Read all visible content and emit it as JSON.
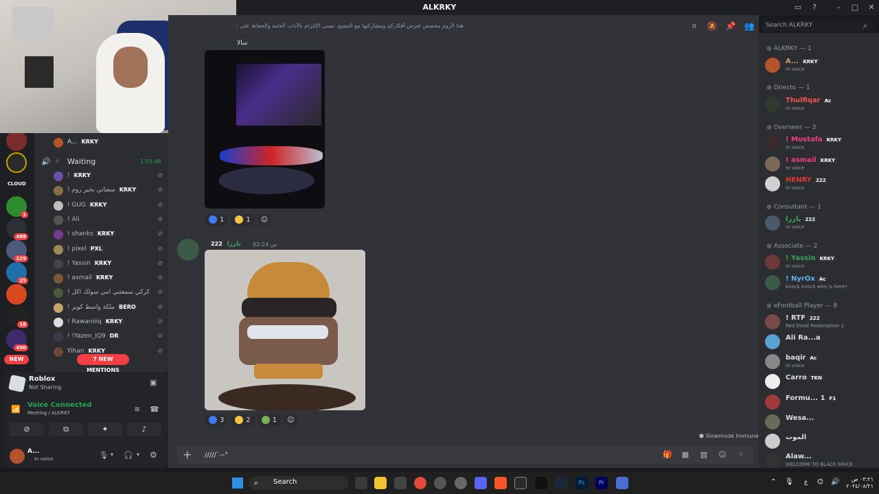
{
  "window": {
    "title": "ALKRKY"
  },
  "header": {
    "topic": "هذا الروم مخصص لعرض أفكاركم ومشاركتها مع الجميع، نتمنى الإلتزام بالآداب العامة والحفاظ على جودة المحتوى",
    "search_placeholder": "Search ALKRKY"
  },
  "sidebar": {
    "server_badges": [
      "1",
      "488",
      "229",
      "25",
      "18",
      "490"
    ],
    "new_label": "NEW",
    "server_logo_text": "CLOUD"
  },
  "voice_list": {
    "top_user": {
      "name": "A...",
      "tag": "KRKY"
    },
    "channel_name": "Waiting",
    "channel_timer": "1:55:46",
    "members": [
      {
        "name": "!",
        "tag": "KRKY"
      },
      {
        "name": "! سعناني بخير روم",
        "tag": "KRKY"
      },
      {
        "name": "! GUG",
        "tag": "KRKY"
      },
      {
        "name": "! Ali",
        "tag": ""
      },
      {
        "name": "! shanks",
        "tag": "KRKY"
      },
      {
        "name": "! pixel",
        "tag": "PXL"
      },
      {
        "name": "! Yassin",
        "tag": "KRKY"
      },
      {
        "name": "! asmail",
        "tag": "KRKY"
      },
      {
        "name": "! كركي سمعتني امي سولك اكل",
        "tag": ""
      },
      {
        "name": "! ملكة واسط كوير",
        "tag": "BERO"
      },
      {
        "name": "! Rawaniiiq",
        "tag": "KRKY"
      },
      {
        "name": "! !Yazen_IQ9",
        "tag": "DR"
      },
      {
        "name": "Yihan",
        "tag": "KRKY"
      }
    ],
    "mentions_label": "7 NEW MENTIONS"
  },
  "activity": {
    "app": "Roblox",
    "status": "Not Sharing"
  },
  "voice_status": {
    "title": "Voice Connected",
    "subtitle": "Meeting / ALKRKY"
  },
  "current_user": {
    "name": "A...",
    "status": "In voice"
  },
  "chat": {
    "first_author_fragment": "سالا",
    "message1_reactions": [
      {
        "emoji": "blue-heart",
        "count": "1"
      },
      {
        "emoji": "laughing",
        "count": "1"
      }
    ],
    "message2": {
      "author": "بارزا",
      "tag": "222",
      "time": "س 02:24"
    },
    "message2_reactions": [
      {
        "emoji": "blue-heart",
        "count": "3"
      },
      {
        "emoji": "laughing",
        "count": "2"
      },
      {
        "emoji": "nauseated",
        "count": "1"
      }
    ],
    "slowmode_label": "Slowmode Immune",
    "composer_text": "/////`--°"
  },
  "members": {
    "roles": [
      {
        "label": "ALKRKY — 1",
        "members": [
          {
            "name": "A...",
            "tag": "KRKY",
            "sub": "In voice",
            "color": "#c9a26a"
          }
        ]
      },
      {
        "label": "Directo — 1",
        "members": [
          {
            "name": "Thulfiqar",
            "tag": "Ac",
            "sub": "In voice",
            "color": "#f2544f"
          }
        ]
      },
      {
        "label": "Overseer — 3",
        "members": [
          {
            "name": "! Mustafa",
            "tag": "KRKY",
            "sub": "In voice",
            "color": "#f23f80"
          },
          {
            "name": "! asmail",
            "tag": "KRKY",
            "sub": "In voice",
            "color": "#f23f80"
          },
          {
            "name": "HENRY",
            "tag": "222",
            "sub": "In voice",
            "color": "#e03a3a"
          }
        ]
      },
      {
        "label": "Consultant — 1",
        "members": [
          {
            "name": "بارزا",
            "tag": "222",
            "sub": "In voice",
            "color": "#3ba55d"
          }
        ]
      },
      {
        "label": "Associate — 2",
        "members": [
          {
            "name": "! Yassin",
            "tag": "KRKY",
            "sub": "In voice",
            "color": "#3ba55d"
          },
          {
            "name": "! NyrOx",
            "tag": "Ac",
            "sub": "knock knock who is here?",
            "color": "#5fb3f2"
          }
        ]
      },
      {
        "label": "eFootball Player — 8",
        "members": [
          {
            "name": "! RTF",
            "tag": "222",
            "sub": "Red Dead Redemption 2",
            "color": "#dbdee1"
          },
          {
            "name": "Ali Ra...a",
            "tag": "",
            "sub": "",
            "color": "#dbdee1"
          },
          {
            "name": "baqir",
            "tag": "Ac",
            "sub": "In voice",
            "color": "#dbdee1"
          },
          {
            "name": "Carro",
            "tag": "TKN",
            "sub": "",
            "color": "#dbdee1"
          },
          {
            "name": "Formu... 1",
            "tag": "F1",
            "sub": "",
            "color": "#dbdee1"
          },
          {
            "name": "Wesa...",
            "tag": "",
            "sub": "",
            "color": "#dbdee1"
          },
          {
            "name": "الموت",
            "tag": "",
            "sub": "",
            "color": "#dbdee1"
          },
          {
            "name": "Alaw...",
            "tag": "",
            "sub": "WELCOME TO BLACK SPACE",
            "color": "#dbdee1"
          }
        ]
      }
    ]
  },
  "taskbar": {
    "search_label": "Search",
    "time": "٠٣:٢١ ص",
    "date": "٢٠٢٤/٠٨/٢١",
    "lang": "ع"
  },
  "colors": {
    "accent": "#5865f2",
    "green": "#23a559",
    "red": "#f23f43"
  }
}
